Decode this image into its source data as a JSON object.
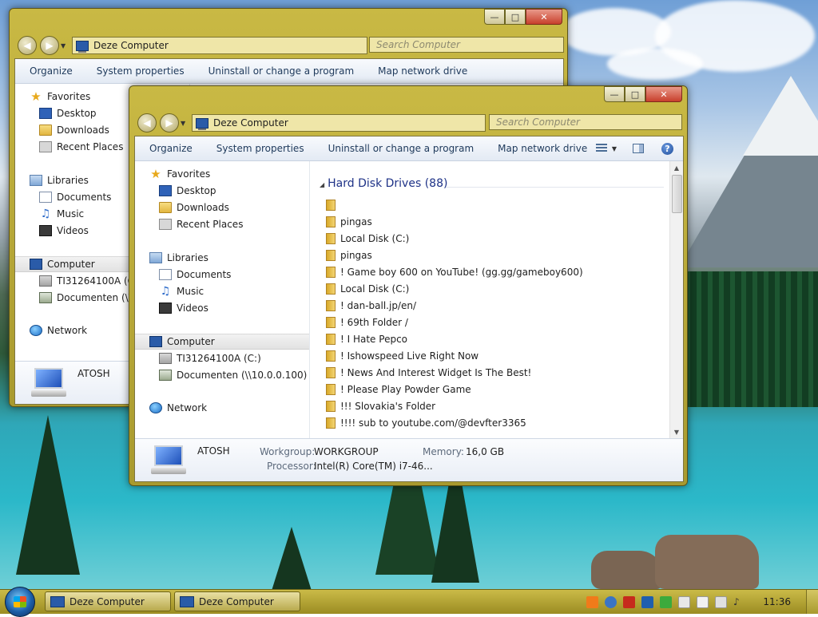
{
  "windows": {
    "back": {
      "address": "Deze Computer",
      "search_placeholder": "Search Computer",
      "toolbar": [
        "Organize",
        "System properties",
        "Uninstall or change a program",
        "Map network drive"
      ],
      "nav": {
        "favorites": "Favorites",
        "desktop": "Desktop",
        "downloads": "Downloads",
        "recent": "Recent Places",
        "libraries": "Libraries",
        "documents": "Documents",
        "music": "Music",
        "videos": "Videos",
        "computer": "Computer",
        "drive_c": "TI31264100A (C:)",
        "drive_x": "Documenten (\\\\1",
        "network": "Network"
      },
      "details_name": "ATOSH"
    },
    "front": {
      "address": "Deze Computer",
      "search_placeholder": "Search Computer",
      "toolbar": [
        "Organize",
        "System properties",
        "Uninstall or change a program",
        "Map network drive"
      ],
      "nav": {
        "favorites": "Favorites",
        "desktop": "Desktop",
        "downloads": "Downloads",
        "recent": "Recent Places",
        "libraries": "Libraries",
        "documents": "Documents",
        "music": "Music",
        "videos": "Videos",
        "computer": "Computer",
        "drive_c": "TI31264100A (C:)",
        "drive_x": "Documenten (\\\\10.0.0.100) (X:)",
        "network": "Network"
      },
      "group_header": "Hard Disk Drives (88)",
      "files": [
        "",
        "pingas",
        "Local Disk (C:)",
        "pingas",
        "! Game boy 600 on YouTube! (gg.gg/gameboy600)",
        "Local Disk (C:)",
        "! dan-ball.jp/en/",
        "! 69th Folder /",
        "! I Hate Pepco",
        "! Ishowspeed Live Right Now",
        "! News And Interest Widget Is The Best!",
        "! Please Play Powder Game",
        "!!! Slovakia's Folder",
        "!!!! sub to youtube.com/@devfter3365"
      ],
      "details": {
        "name": "ATOSH",
        "workgroup_label": "Workgroup:",
        "workgroup_value": "WORKGROUP",
        "memory_label": "Memory:",
        "memory_value": "16,0 GB",
        "processor_label": "Processor:",
        "processor_value": "Intel(R) Core(TM) i7-46..."
      }
    }
  },
  "taskbar": {
    "buttons": [
      "Deze Computer",
      "Deze Computer"
    ],
    "clock": "11:36"
  },
  "colors": {
    "frame": "#b8a93a",
    "toolbar_text": "#1e395b",
    "group_header": "#1e3287"
  }
}
